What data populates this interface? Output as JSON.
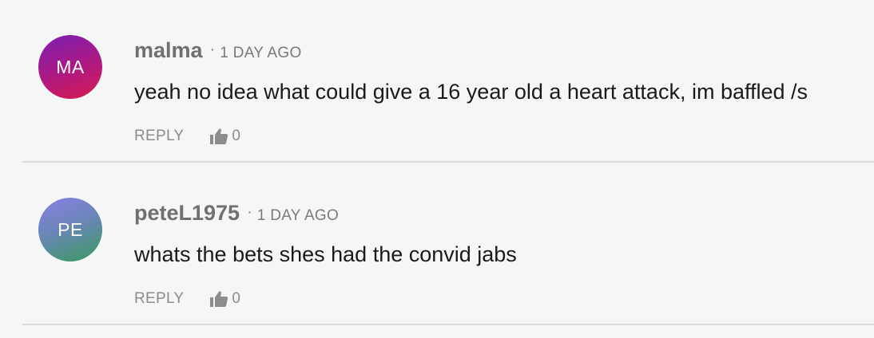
{
  "comments": [
    {
      "initials": "MA",
      "author": "malma",
      "separator": "·",
      "time": "1 DAY AGO",
      "text": "yeah no idea what could give a 16 year old a heart attack, im baffled /s",
      "reply_label": "REPLY",
      "like_icon": "thumbs-up-icon",
      "likes": "0"
    },
    {
      "initials": "PE",
      "author": "peteL1975",
      "separator": "·",
      "time": "1 DAY AGO",
      "text": "whats the bets shes had the convid jabs",
      "reply_label": "REPLY",
      "like_icon": "thumbs-up-icon",
      "likes": "0"
    }
  ]
}
